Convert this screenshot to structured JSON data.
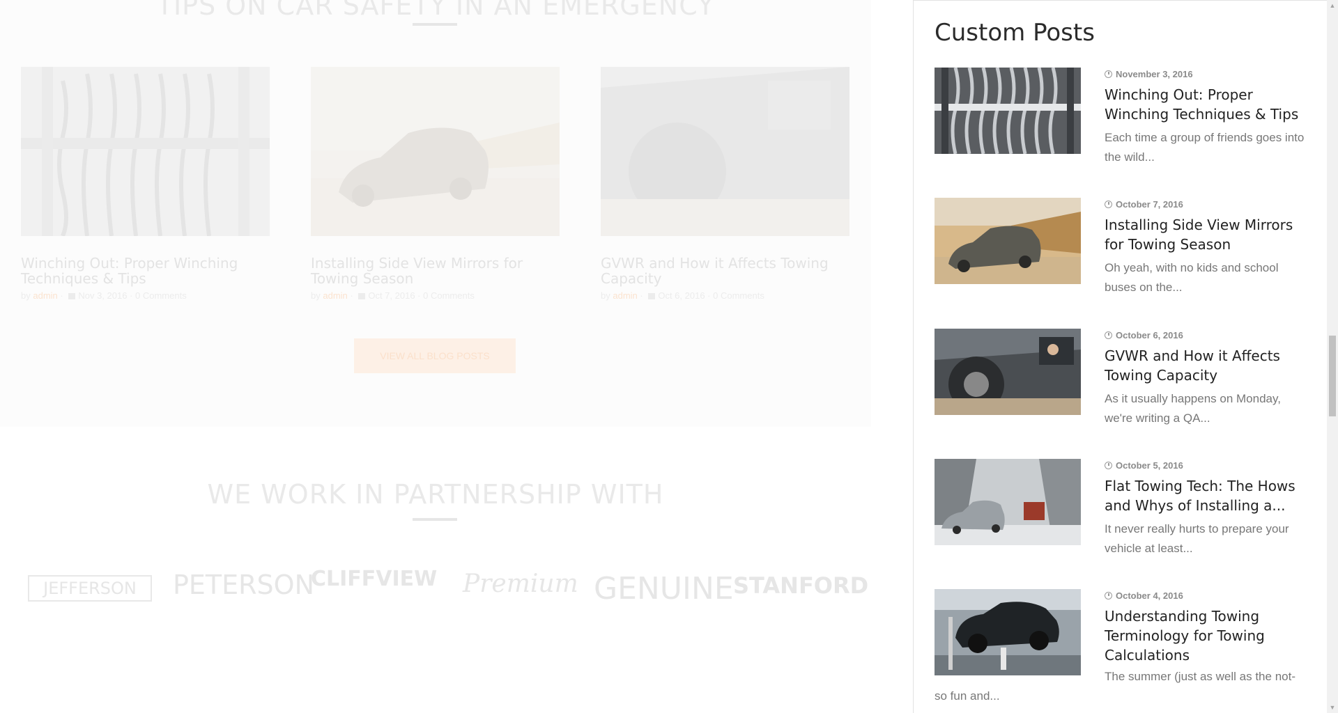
{
  "blog_section": {
    "title": "TIPS ON CAR SAFETY IN AN EMERGENCY",
    "posts": [
      {
        "title": "Winching Out: Proper Winching Techniques & Tips",
        "by": "by",
        "author": "admin",
        "date": "Nov 3, 2016",
        "comments": "0 Comments"
      },
      {
        "title": "Installing Side View Mirrors for Towing Season",
        "by": "by",
        "author": "admin",
        "date": "Oct 7, 2016",
        "comments": "0 Comments"
      },
      {
        "title": "GVWR and How it Affects Towing Capacity",
        "by": "by",
        "author": "admin",
        "date": "Oct 6, 2016",
        "comments": "0 Comments"
      }
    ],
    "view_all_label": "VIEW ALL BLOG POSTS"
  },
  "partners": {
    "title": "WE WORK IN PARTNERSHIP WITH",
    "logos": [
      "JEFFERSON",
      "PETERSON",
      "CLIFFVIEW",
      "Premium",
      "GENUINE",
      "STANFORD"
    ]
  },
  "sidebar": {
    "title": "Custom Posts",
    "posts": [
      {
        "date": "November 3, 2016",
        "title": "Winching Out: Proper Winching Techniques & Tips",
        "excerpt": "Each time a group of friends goes into the wild..."
      },
      {
        "date": "October 7, 2016",
        "title": "Installing Side View Mirrors for Towing Season",
        "excerpt": "Oh yeah, with no kids and school buses on the..."
      },
      {
        "date": "October 6, 2016",
        "title": "GVWR and How it Affects Towing Capacity",
        "excerpt": "As it usually happens on Monday, we're writing a QA..."
      },
      {
        "date": "October 5, 2016",
        "title": "Flat Towing Tech: The Hows and Whys of Installing a...",
        "excerpt": "It never really hurts to prepare your vehicle at least..."
      },
      {
        "date": "October 4, 2016",
        "title": "Understanding Towing Terminology for Towing Calculations",
        "excerpt": "The summer (just as well as the not-so fun and..."
      }
    ]
  },
  "colors": {
    "accent": "#f7a35c",
    "text_dark": "#222222",
    "text_muted": "#777777"
  }
}
